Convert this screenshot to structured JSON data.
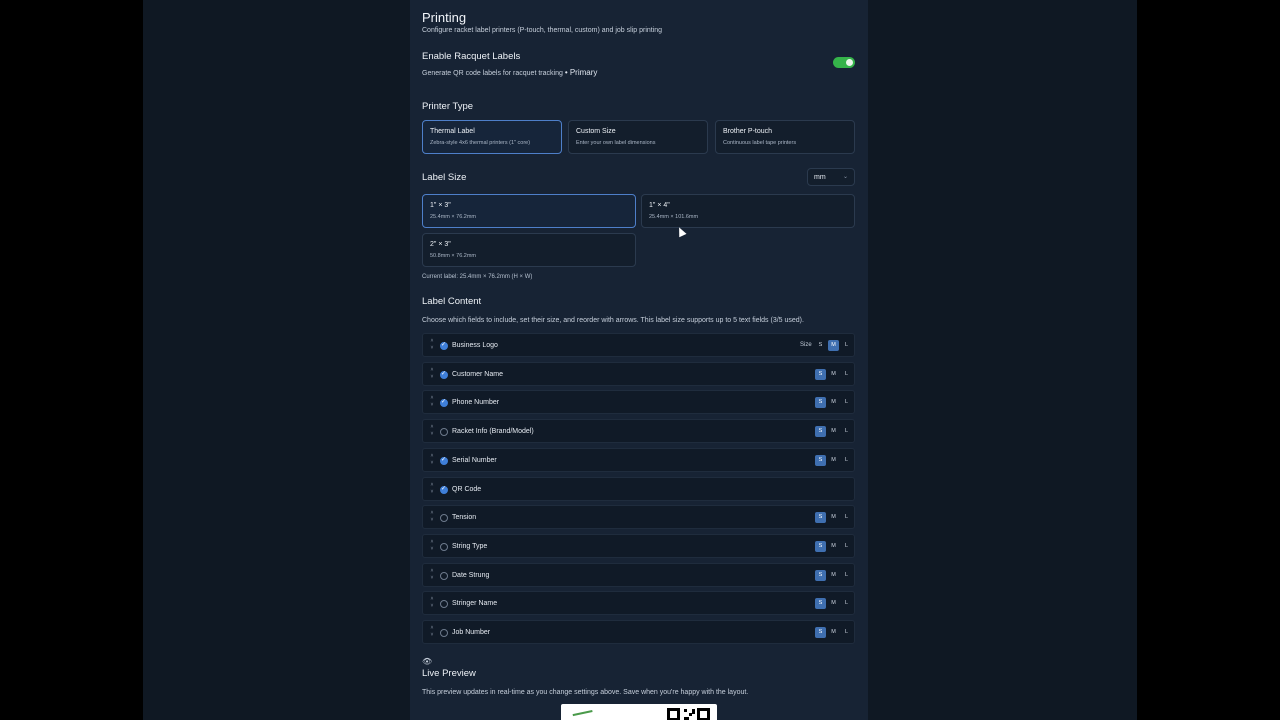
{
  "header": {
    "title": "Printing",
    "subtitle": "Configure racket label printers (P-touch, thermal, custom) and job slip printing"
  },
  "enable_labels": {
    "title": "Enable Racquet Labels",
    "desc": "Generate QR code labels for racquet tracking",
    "tag": "• Primary",
    "enabled": true,
    "toggle_color": "#35b34a"
  },
  "printer_type": {
    "title": "Printer Type",
    "options": [
      {
        "label": "Thermal Label",
        "desc": "Zebra-style 4x6 thermal printers (1\" core)",
        "selected": true
      },
      {
        "label": "Custom Size",
        "desc": "Enter your own label dimensions",
        "selected": false
      },
      {
        "label": "Brother P-touch",
        "desc": "Continuous label tape printers",
        "selected": false
      }
    ]
  },
  "label_size": {
    "title": "Label Size",
    "unit": "mm",
    "options": [
      {
        "label": "1\" × 3\"",
        "desc": "25.4mm × 76.2mm",
        "selected": true
      },
      {
        "label": "1\" × 4\"",
        "desc": "25.4mm × 101.6mm",
        "selected": false
      },
      {
        "label": "2\" × 3\"",
        "desc": "50.8mm × 76.2mm",
        "selected": false
      }
    ],
    "current": "Current label: 25.4mm × 76.2mm (H × W)"
  },
  "label_content": {
    "title": "Label Content",
    "desc": "Choose which fields to include, set their size, and reorder with arrows. This label size supports up to 5 text fields (3/5 used).",
    "size_label": "Size",
    "size_letters": [
      "S",
      "M",
      "L"
    ],
    "fields": [
      {
        "label": "Business Logo",
        "checked": true,
        "size": "M",
        "show_size_label": true,
        "has_size": true
      },
      {
        "label": "Customer Name",
        "checked": true,
        "size": "S",
        "has_size": true
      },
      {
        "label": "Phone Number",
        "checked": true,
        "size": "S",
        "has_size": true
      },
      {
        "label": "Racket Info (Brand/Model)",
        "checked": false,
        "size": "S",
        "has_size": true
      },
      {
        "label": "Serial Number",
        "checked": true,
        "size": "S",
        "has_size": true
      },
      {
        "label": "QR Code",
        "checked": true,
        "size": "",
        "has_size": false
      },
      {
        "label": "Tension",
        "checked": false,
        "size": "S",
        "has_size": true
      },
      {
        "label": "String Type",
        "checked": false,
        "size": "S",
        "has_size": true
      },
      {
        "label": "Date Strung",
        "checked": false,
        "size": "S",
        "has_size": true
      },
      {
        "label": "Stringer Name",
        "checked": false,
        "size": "S",
        "has_size": true
      },
      {
        "label": "Job Number",
        "checked": false,
        "size": "S",
        "has_size": true
      }
    ]
  },
  "live_preview": {
    "icon": "eye-icon",
    "title": "Live Preview",
    "desc": "This preview updates in real-time as you change settings above. Save when you're happy with the layout."
  },
  "colors": {
    "accent": "#3f7fd9",
    "panel": "#172334"
  }
}
